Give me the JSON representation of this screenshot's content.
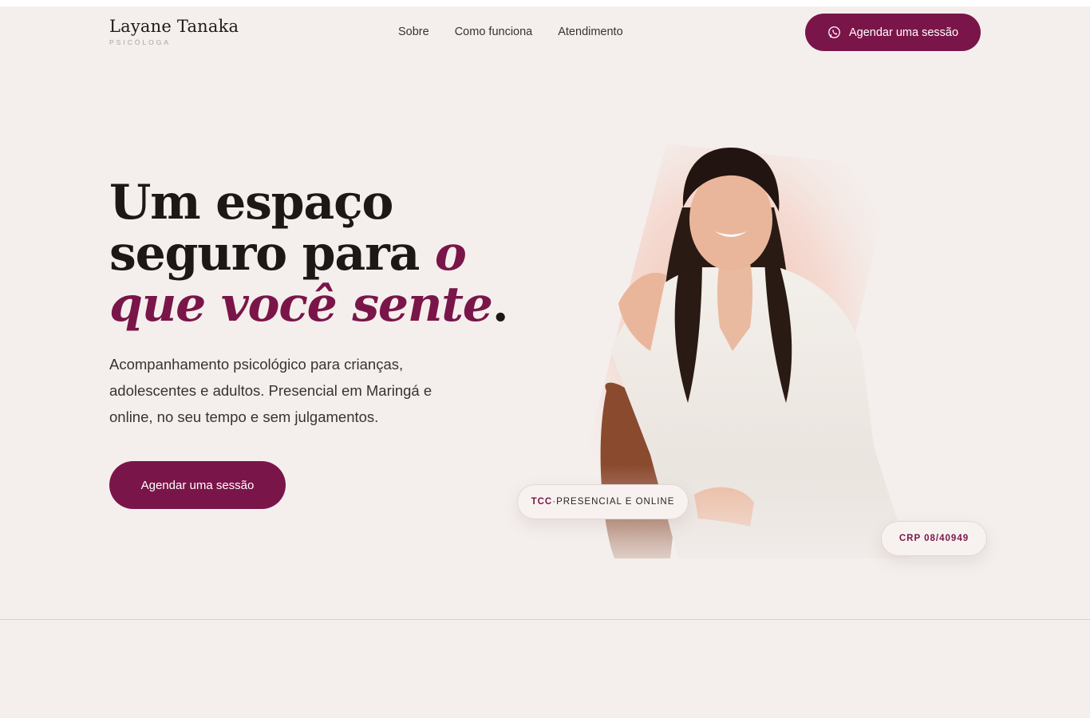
{
  "brand": {
    "name": "Layane Tanaka",
    "subtitle": "PSICÓLOGA"
  },
  "nav": {
    "links": [
      "Sobre",
      "Como funciona",
      "Atendimento"
    ],
    "cta_label": "Agendar uma sessão",
    "cta_icon": "whatsapp-icon"
  },
  "hero": {
    "title_part1": "Um espaço seguro para ",
    "title_accent": "o que você sente",
    "title_end": ".",
    "subtitle": "Acompanhamento psicológico para crianças, adolescentes e adultos. Presencial em Maringá e online, no seu tempo e sem julgamentos.",
    "cta_label": "Agendar uma sessão"
  },
  "badges": {
    "approach": "TCC",
    "separator": " · ",
    "mode": "PRESENCIAL E ONLINE",
    "crp": "CRP 08/40949"
  },
  "colors": {
    "accent": "#7a1549",
    "background": "#f4efed",
    "text": "#1d1816"
  }
}
